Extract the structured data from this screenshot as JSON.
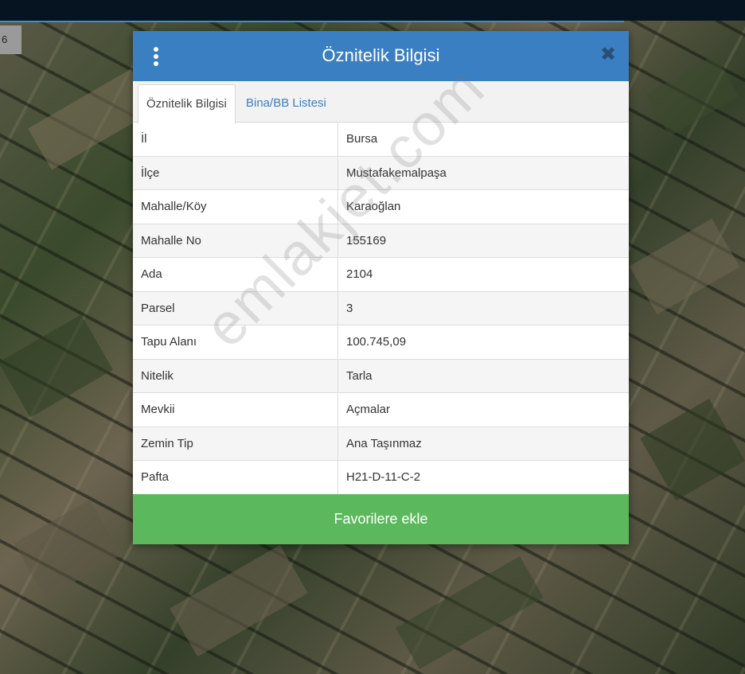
{
  "map": {
    "zoom_badge": "6"
  },
  "dialog": {
    "title": "Öznitelik Bilgisi",
    "menu_icon": "vertical-dots-icon",
    "close_icon": "close-icon",
    "close_glyph": "✖",
    "tabs": [
      {
        "label": "Öznitelik Bilgisi",
        "active": true
      },
      {
        "label": "Bina/BB Listesi",
        "active": false
      }
    ],
    "rows": [
      {
        "key": "İl",
        "value": "Bursa"
      },
      {
        "key": "İlçe",
        "value": "Mustafakemalpaşa"
      },
      {
        "key": "Mahalle/Köy",
        "value": "Karaoğlan"
      },
      {
        "key": "Mahalle No",
        "value": "155169"
      },
      {
        "key": "Ada",
        "value": "2104"
      },
      {
        "key": "Parsel",
        "value": "3"
      },
      {
        "key": "Tapu Alanı",
        "value": "100.745,09"
      },
      {
        "key": "Nitelik",
        "value": "Tarla"
      },
      {
        "key": "Mevkii",
        "value": "Açmalar"
      },
      {
        "key": "Zemin Tip",
        "value": "Ana Taşınmaz"
      },
      {
        "key": "Pafta",
        "value": "H21-D-11-C-2"
      }
    ],
    "favorite_button": "Favorilere ekle"
  },
  "watermark": "emlakjet.com",
  "colors": {
    "header": "#3a7fc2",
    "button": "#5cb85c",
    "tab_link": "#3a7fc2",
    "topbar": "#061421"
  }
}
